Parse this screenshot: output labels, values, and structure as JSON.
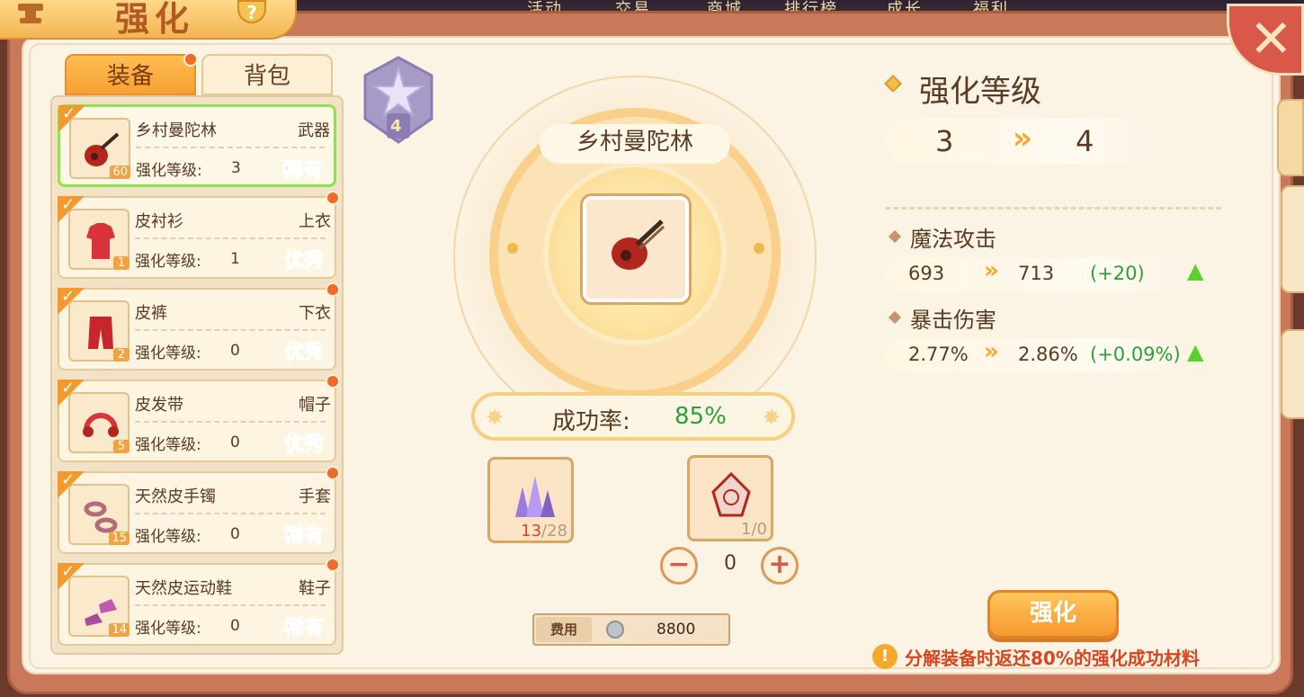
{
  "topnav": [
    "活动",
    "交易",
    "商城",
    "排行榜",
    "成长",
    "福利"
  ],
  "title": "强化",
  "help_label": "?",
  "tabs": [
    {
      "label": "装备",
      "active": true
    },
    {
      "label": "背包",
      "active": false
    }
  ],
  "equipment": [
    {
      "name": "乡村曼陀林",
      "slot": "武器",
      "level_label": "强化等级:",
      "level": "3",
      "item_level": "60",
      "quality": "稀有",
      "quality_class": "rare",
      "selected": true,
      "icon": "mandolin-icon"
    },
    {
      "name": "皮衬衫",
      "slot": "上衣",
      "level_label": "强化等级:",
      "level": "1",
      "item_level": "1",
      "quality": "优秀",
      "quality_class": "good",
      "selected": false,
      "icon": "shirt-icon"
    },
    {
      "name": "皮裤",
      "slot": "下衣",
      "level_label": "强化等级:",
      "level": "0",
      "item_level": "2",
      "quality": "优秀",
      "quality_class": "good",
      "selected": false,
      "icon": "pants-icon"
    },
    {
      "name": "皮发带",
      "slot": "帽子",
      "level_label": "强化等级:",
      "level": "0",
      "item_level": "5",
      "quality": "优秀",
      "quality_class": "good",
      "selected": false,
      "icon": "headband-icon"
    },
    {
      "name": "天然皮手镯",
      "slot": "手套",
      "level_label": "强化等级:",
      "level": "0",
      "item_level": "15",
      "quality": "稀有",
      "quality_class": "rare",
      "selected": false,
      "icon": "bracelet-icon"
    },
    {
      "name": "天然皮运动鞋",
      "slot": "鞋子",
      "level_label": "强化等级:",
      "level": "0",
      "item_level": "14",
      "quality": "稀有",
      "quality_class": "rare",
      "selected": false,
      "icon": "shoes-icon"
    }
  ],
  "star_badge": "4",
  "selected_item": {
    "name": "乡村曼陀林",
    "icon": "mandolin-icon"
  },
  "success": {
    "label": "成功率:",
    "value": "85%"
  },
  "materials": [
    {
      "icon": "crystal-icon",
      "have": "13",
      "need": "/28"
    },
    {
      "icon": "rune-stone-icon",
      "count": "1/0"
    }
  ],
  "stepper": {
    "value": "0",
    "minus": "−",
    "plus": "+"
  },
  "cost": {
    "label": "费用",
    "value": "8800",
    "icon": "silver-coin-icon"
  },
  "enhance_level": {
    "title": "强化等级",
    "from": "3",
    "to": "4"
  },
  "stats": [
    {
      "name": "魔法攻击",
      "from": "693",
      "to": "713",
      "delta": "(+20)"
    },
    {
      "name": "暴击伤害",
      "from": "2.77%",
      "to": "2.86%",
      "delta": "(+0.09%)"
    }
  ],
  "enhance_button": "强化",
  "warning": "分解装备时返还80%的强化成功材料",
  "colors": {
    "rare": "#b04ae0",
    "good": "#32b42a",
    "accent": "#f6a032",
    "success": "#2aa23a",
    "warning": "#d9451e"
  }
}
